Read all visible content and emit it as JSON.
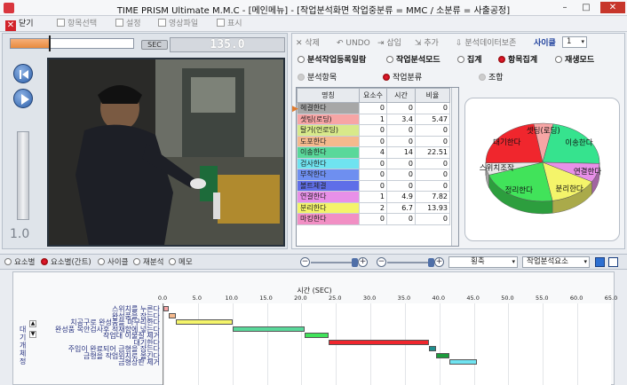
{
  "window": {
    "title": "TIME PRISM Ultimate M.M.C - [메인메뉴] - [작업분석화면 작업중분류 = MMC  /  소분류 = 사출공정]",
    "controls": [
      "–",
      "□",
      "✕"
    ]
  },
  "toolbar": {
    "close_label": "닫기",
    "items": [
      "항목선택",
      "설정",
      "영상파일",
      "표시"
    ]
  },
  "player": {
    "progress_fraction": 0.32,
    "sec_label": "SEC",
    "time_value": "135.0",
    "speed_value": "1.0",
    "colors": {
      "progress": "#e88a3e"
    }
  },
  "analysis_toolbar": {
    "delete_label": "삭제",
    "undo_label": "UNDO",
    "insert_label": "삽입",
    "add_label": "추가",
    "save_label": "분석데이터보존",
    "thickness_label": "사이클",
    "thickness_value": "1"
  },
  "tabs": [
    {
      "label": "분석작업등록일람",
      "active": false
    },
    {
      "label": "작업분석모드",
      "active": false
    },
    {
      "label": "집계",
      "active": false
    },
    {
      "label": "항목집계",
      "active": true
    },
    {
      "label": "재생모드",
      "active": false
    }
  ],
  "subtabs": [
    {
      "label": "분석항목",
      "active": false
    },
    {
      "label": "작업분류",
      "active": true
    },
    {
      "label": "조합",
      "active": false
    }
  ],
  "table": {
    "headers": [
      "명칭",
      "요소수",
      "시간",
      "비율"
    ],
    "rows": [
      {
        "name": "헤결한다",
        "count": "0",
        "time": "0",
        "ratio": "0",
        "color": "#a7a7a7"
      },
      {
        "name": "셋팅(로딩)",
        "count": "1",
        "time": "3.4",
        "ratio": "5.47",
        "color": "#f7a5a5"
      },
      {
        "name": "탈거(언로딩)",
        "count": "0",
        "time": "0",
        "ratio": "0",
        "color": "#d8e98a"
      },
      {
        "name": "도포한다",
        "count": "0",
        "time": "0",
        "ratio": "0",
        "color": "#f5b98d"
      },
      {
        "name": "이송한다",
        "count": "4",
        "time": "14",
        "ratio": "22.51",
        "color": "#59d89a"
      },
      {
        "name": "검사한다",
        "count": "0",
        "time": "0",
        "ratio": "0",
        "color": "#6fe3f0"
      },
      {
        "name": "부착한다",
        "count": "0",
        "time": "0",
        "ratio": "0",
        "color": "#6e8ff0"
      },
      {
        "name": "볼트체결",
        "count": "0",
        "time": "0",
        "ratio": "0",
        "color": "#5f6ee8"
      },
      {
        "name": "연결한다",
        "count": "1",
        "time": "4.9",
        "ratio": "7.82",
        "color": "#e890e8"
      },
      {
        "name": "분리한다",
        "count": "2",
        "time": "6.7",
        "ratio": "13.93",
        "color": "#f4f46a"
      },
      {
        "name": "마킹한다",
        "count": "0",
        "time": "0",
        "ratio": "0",
        "color": "#f18fc4"
      }
    ]
  },
  "pie": {
    "slices": [
      {
        "label": "셋팅(로딩)",
        "value": 5.47,
        "color": "#f7a5a5"
      },
      {
        "label": "이송한다",
        "value": 22.51,
        "color": "#36e38e"
      },
      {
        "label": "연결한다",
        "value": 7.82,
        "color": "#e890e8"
      },
      {
        "label": "분리한다",
        "value": 13.93,
        "color": "#f4f46a"
      },
      {
        "label": "정리한다",
        "value": 22.5,
        "color": "#41e35a"
      },
      {
        "label": "스위치조작",
        "value": 5.0,
        "color": "#e9e9e9"
      },
      {
        "label": "대기한다",
        "value": 22.77,
        "color": "#f0262d"
      }
    ]
  },
  "bottom_tabs": [
    {
      "label": "요소별",
      "active": false
    },
    {
      "label": "요소별(간트)",
      "active": true
    },
    {
      "label": "사이클",
      "active": false
    },
    {
      "label": "재분석",
      "active": false
    },
    {
      "label": "메모",
      "active": false
    }
  ],
  "bottom_controls": {
    "axis_select": "횡축",
    "element_select": "작업분석요소"
  },
  "gantt": {
    "axis_title": "시간 (SEC)",
    "ticks": [
      "0.0",
      "5.0",
      "10.0",
      "15.0",
      "20.0",
      "25.0",
      "30.0",
      "35.0",
      "40.0",
      "45.0",
      "50.0",
      "55.0",
      "60.0",
      "65.0"
    ],
    "vertical_label": "대기개체정",
    "rows": [
      {
        "label": "스위치를 누른다",
        "start": 0.0,
        "end": 0.8,
        "color": "#f7a5a5"
      },
      {
        "label": "완성품을 잡는다",
        "start": 0.8,
        "end": 1.8,
        "color": "#f5b98d"
      },
      {
        "label": "치공구로 완성품을 마무리한다",
        "start": 1.8,
        "end": 10.0,
        "color": "#f4f46a"
      },
      {
        "label": "완성품 목안검사후 적재함에 넣는다",
        "start": 10.0,
        "end": 20.5,
        "color": "#59d89a"
      },
      {
        "label": "작업대 이물질 제거",
        "start": 20.5,
        "end": 24.0,
        "color": "#41e35a"
      },
      {
        "label": "대기한다",
        "start": 24.0,
        "end": 38.5,
        "color": "#f0262d"
      },
      {
        "label": "주입이 완료되어 금형을 잡는다",
        "start": 38.5,
        "end": 39.5,
        "color": "#1f8f8f"
      },
      {
        "label": "금형을 작업위치로 옮긴다",
        "start": 39.5,
        "end": 41.5,
        "color": "#1c9c3c"
      },
      {
        "label": "금형상판 제거",
        "start": 41.5,
        "end": 45.5,
        "color": "#6fe3f0"
      }
    ]
  }
}
